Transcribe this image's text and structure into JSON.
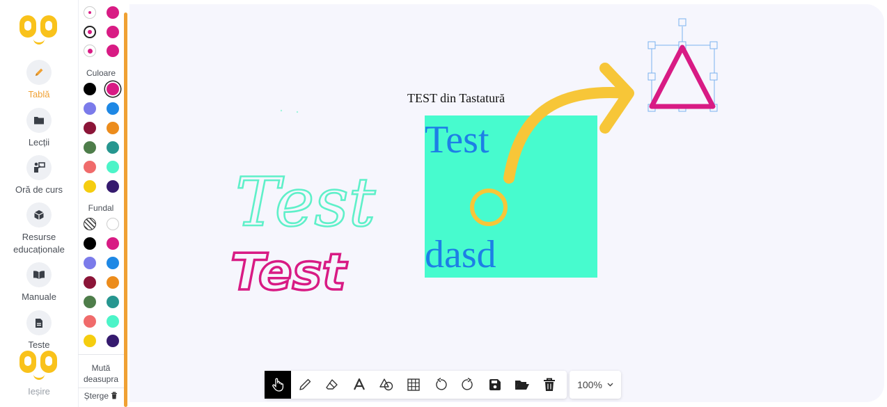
{
  "nav": {
    "items": [
      {
        "label": "Tablă",
        "icon": "pencil-icon",
        "active": true
      },
      {
        "label": "Lecții",
        "icon": "folder-icon"
      },
      {
        "label": "Oră de curs",
        "icon": "teacher-icon"
      },
      {
        "label": "Resurse educaționale",
        "icon": "cube-icon"
      },
      {
        "label": "Manuale",
        "icon": "book-icon"
      },
      {
        "label": "Teste",
        "icon": "document-icon"
      },
      {
        "label": "Ieșire",
        "icon": "logout-icon"
      }
    ]
  },
  "palette": {
    "size_options": [
      "small",
      "medium",
      "large"
    ],
    "color_heading": "Culoare",
    "background_heading": "Fundal",
    "colors": [
      "#000000",
      "#d81b84",
      "#7b7bea",
      "#1e88e5",
      "#8b1538",
      "#ec8c1c",
      "#4e7d4a",
      "#26968f",
      "#f06b6b",
      "#4cf4c8",
      "#f5cd0f",
      "#351a6e"
    ],
    "selected_color": "#d81b84",
    "bring_front_label": "Mută deasupra",
    "delete_label": "Șterge"
  },
  "canvas": {
    "keyboard_text": "TEST din Tastatură",
    "box_text_top": "Test",
    "box_text_bottom": "dasd",
    "handwriting_1": "Test",
    "handwriting_2": "Test",
    "box_color": "#47fbce",
    "box_text_color": "#1d7fe6"
  },
  "toolbar": {
    "tools": [
      "hand-icon",
      "pencil-icon",
      "eraser-icon",
      "text-icon",
      "shapes-icon",
      "grid-icon",
      "undo-icon",
      "redo-icon",
      "save-icon",
      "open-folder-icon",
      "trash-icon"
    ],
    "active_tool": "hand-icon",
    "zoom": "100%"
  }
}
